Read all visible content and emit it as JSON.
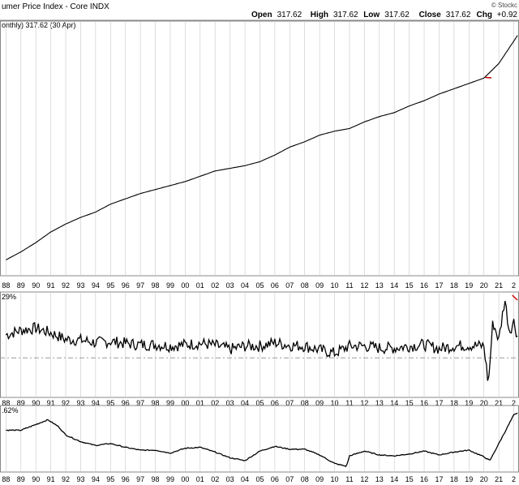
{
  "header": {
    "title": "umer Price Index - Core  INDX",
    "copyright": "© Stockc",
    "ohlc": [
      {
        "label": "Open",
        "value": "317.62"
      },
      {
        "label": "High",
        "value": "317.62"
      },
      {
        "label": "Low",
        "value": "317.62"
      },
      {
        "label": "Close",
        "value": "317.62"
      },
      {
        "label": "Chg",
        "value": "+0.92"
      }
    ]
  },
  "legend_text": "onthly) 317.62 (30 Apr)",
  "panel2_label": "29%",
  "panel3_label": ".62%",
  "colors": {
    "line": "#000000",
    "grid": "#c8c8c8",
    "reference": "#9a9a9a",
    "accent": "#cc0000"
  },
  "chart_data": [
    {
      "type": "line",
      "panel": "price",
      "x": [
        1988,
        1989,
        1990,
        1991,
        1992,
        1993,
        1994,
        1995,
        1996,
        1997,
        1998,
        1999,
        2000,
        2001,
        2002,
        2003,
        2004,
        2005,
        2006,
        2007,
        2008,
        2009,
        2010,
        2011,
        2012,
        2013,
        2014,
        2015,
        2016,
        2017,
        2018,
        2019,
        2020,
        2021,
        2022.3
      ],
      "y": [
        120,
        126,
        133,
        141,
        147,
        152,
        156,
        162,
        166,
        170,
        173,
        176,
        179,
        183,
        187,
        189,
        191,
        194,
        199,
        205,
        209,
        214,
        217,
        219,
        224,
        228,
        231,
        236,
        240,
        245,
        249,
        253,
        257,
        268,
        290
      ],
      "grid": true
    },
    {
      "type": "line",
      "panel": "monthly_change_pct",
      "label": "29%",
      "x": [
        1988,
        1989,
        1990,
        1991,
        1992,
        1993,
        1994,
        1995,
        1996,
        1997,
        1998,
        1999,
        2000,
        2001,
        2002,
        2003,
        2004,
        2005,
        2006,
        2007,
        2008,
        2009,
        2010,
        2011,
        2012,
        2013,
        2014,
        2015,
        2016,
        2017,
        2018,
        2019,
        2020,
        2020.3,
        2020.6,
        2021,
        2021.4,
        2021.7,
        2022,
        2022.3
      ],
      "y": [
        0.35,
        0.42,
        0.45,
        0.38,
        0.28,
        0.27,
        0.23,
        0.25,
        0.22,
        0.2,
        0.2,
        0.18,
        0.2,
        0.22,
        0.19,
        0.13,
        0.18,
        0.18,
        0.23,
        0.19,
        0.18,
        0.12,
        0.07,
        0.18,
        0.18,
        0.15,
        0.15,
        0.18,
        0.2,
        0.14,
        0.18,
        0.19,
        0.18,
        -0.4,
        0.55,
        0.27,
        0.9,
        0.4,
        0.55,
        0.29
      ],
      "grid": true
    },
    {
      "type": "line",
      "panel": "yearly_change_pct",
      "label": ".62%",
      "x": [
        1988,
        1989,
        1990,
        1990.8,
        1991.5,
        1992,
        1993,
        1994,
        1995,
        1996,
        1997,
        1998,
        1999,
        2000,
        2001,
        2002,
        2003,
        2004,
        2005,
        2006,
        2007,
        2008,
        2009,
        2010,
        2010.8,
        2011,
        2012,
        2013,
        2014,
        2015,
        2016,
        2017,
        2018,
        2019,
        2020,
        2020.4,
        2021,
        2021.5,
        2022,
        2022.3
      ],
      "y": [
        4.4,
        4.4,
        5.0,
        5.5,
        4.8,
        3.9,
        3.2,
        2.8,
        3.0,
        2.6,
        2.3,
        2.3,
        2.0,
        2.5,
        2.6,
        2.1,
        1.5,
        1.2,
        2.2,
        2.7,
        2.4,
        2.4,
        1.8,
        0.9,
        0.6,
        1.7,
        2.2,
        1.8,
        1.7,
        1.9,
        2.2,
        1.8,
        2.1,
        2.3,
        1.6,
        1.2,
        3.0,
        4.5,
        6.0,
        6.2
      ],
      "grid": true
    }
  ],
  "x_axis_ticks": [
    "88",
    "89",
    "90",
    "91",
    "92",
    "93",
    "94",
    "95",
    "96",
    "97",
    "98",
    "99",
    "00",
    "01",
    "02",
    "03",
    "04",
    "05",
    "06",
    "07",
    "08",
    "09",
    "10",
    "11",
    "12",
    "13",
    "14",
    "15",
    "16",
    "17",
    "18",
    "19",
    "20",
    "21",
    "2"
  ]
}
